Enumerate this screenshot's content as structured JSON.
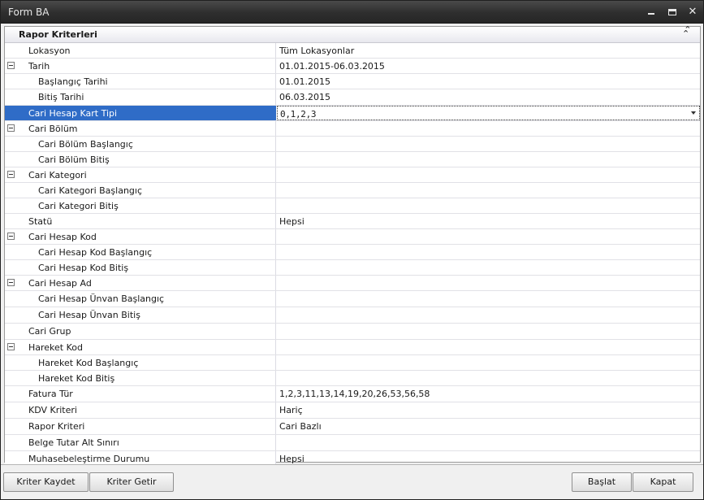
{
  "window": {
    "title": "Form BA"
  },
  "category": {
    "title": "Rapor Kriterleri"
  },
  "rows": [
    {
      "label": "Lokasyon",
      "value": "Tüm Lokasyonlar",
      "level": 0,
      "expander": false
    },
    {
      "label": "Tarih",
      "value": "01.01.2015-06.03.2015",
      "level": 0,
      "expander": true
    },
    {
      "label": "Başlangıç Tarihi",
      "value": "01.01.2015",
      "level": 1,
      "expander": false
    },
    {
      "label": "Bitiş Tarihi",
      "value": "06.03.2015",
      "level": 1,
      "expander": false
    },
    {
      "label": "Cari Hesap Kart Tipi",
      "value": "0,1,2,3",
      "level": 0,
      "expander": false,
      "selected": true
    },
    {
      "label": "Cari Bölüm",
      "value": "",
      "level": 0,
      "expander": true
    },
    {
      "label": "Cari Bölüm Başlangıç",
      "value": "",
      "level": 1,
      "expander": false
    },
    {
      "label": "Cari Bölüm Bitiş",
      "value": "",
      "level": 1,
      "expander": false
    },
    {
      "label": "Cari Kategori",
      "value": "",
      "level": 0,
      "expander": true
    },
    {
      "label": "Cari Kategori Başlangıç",
      "value": "",
      "level": 1,
      "expander": false
    },
    {
      "label": "Cari Kategori Bitiş",
      "value": "",
      "level": 1,
      "expander": false
    },
    {
      "label": "Statü",
      "value": "Hepsi",
      "level": 0,
      "expander": false
    },
    {
      "label": "Cari Hesap Kod",
      "value": "",
      "level": 0,
      "expander": true
    },
    {
      "label": "Cari Hesap Kod Başlangıç",
      "value": "",
      "level": 1,
      "expander": false
    },
    {
      "label": "Cari Hesap Kod Bitiş",
      "value": "",
      "level": 1,
      "expander": false
    },
    {
      "label": "Cari Hesap Ad",
      "value": "",
      "level": 0,
      "expander": true
    },
    {
      "label": "Cari Hesap Ünvan Başlangıç",
      "value": "",
      "level": 1,
      "expander": false
    },
    {
      "label": "Cari Hesap Ünvan Bitiş",
      "value": "",
      "level": 1,
      "expander": false
    },
    {
      "label": "Cari Grup",
      "value": "",
      "level": 0,
      "expander": false
    },
    {
      "label": "Hareket Kod",
      "value": "",
      "level": 0,
      "expander": true
    },
    {
      "label": "Hareket Kod Başlangıç",
      "value": "",
      "level": 1,
      "expander": false
    },
    {
      "label": "Hareket Kod Bitiş",
      "value": "",
      "level": 1,
      "expander": false
    },
    {
      "label": "Fatura Tür",
      "value": "1,2,3,11,13,14,19,20,26,53,56,58",
      "level": 0,
      "expander": false
    },
    {
      "label": "KDV Kriteri",
      "value": "Hariç",
      "level": 0,
      "expander": false
    },
    {
      "label": "Rapor Kriteri",
      "value": "Cari Bazlı",
      "level": 0,
      "expander": false
    },
    {
      "label": "Belge Tutar Alt Sınırı",
      "value": "",
      "level": 0,
      "expander": false
    },
    {
      "label": "Muhasebeleştirme Durumu",
      "value": "Hepsi",
      "level": 0,
      "expander": false
    }
  ],
  "buttons": {
    "save_criteria": "Kriter Kaydet",
    "load_criteria": "Kriter Getir",
    "start": "Başlat",
    "close": "Kapat"
  },
  "icons": {
    "minimize": "minimize-icon",
    "maximize": "maximize-icon",
    "close": "close-icon",
    "collapse": "double-chevron-up-icon",
    "expander": "minus-box-icon",
    "dropdown": "dropdown-arrow-icon"
  }
}
